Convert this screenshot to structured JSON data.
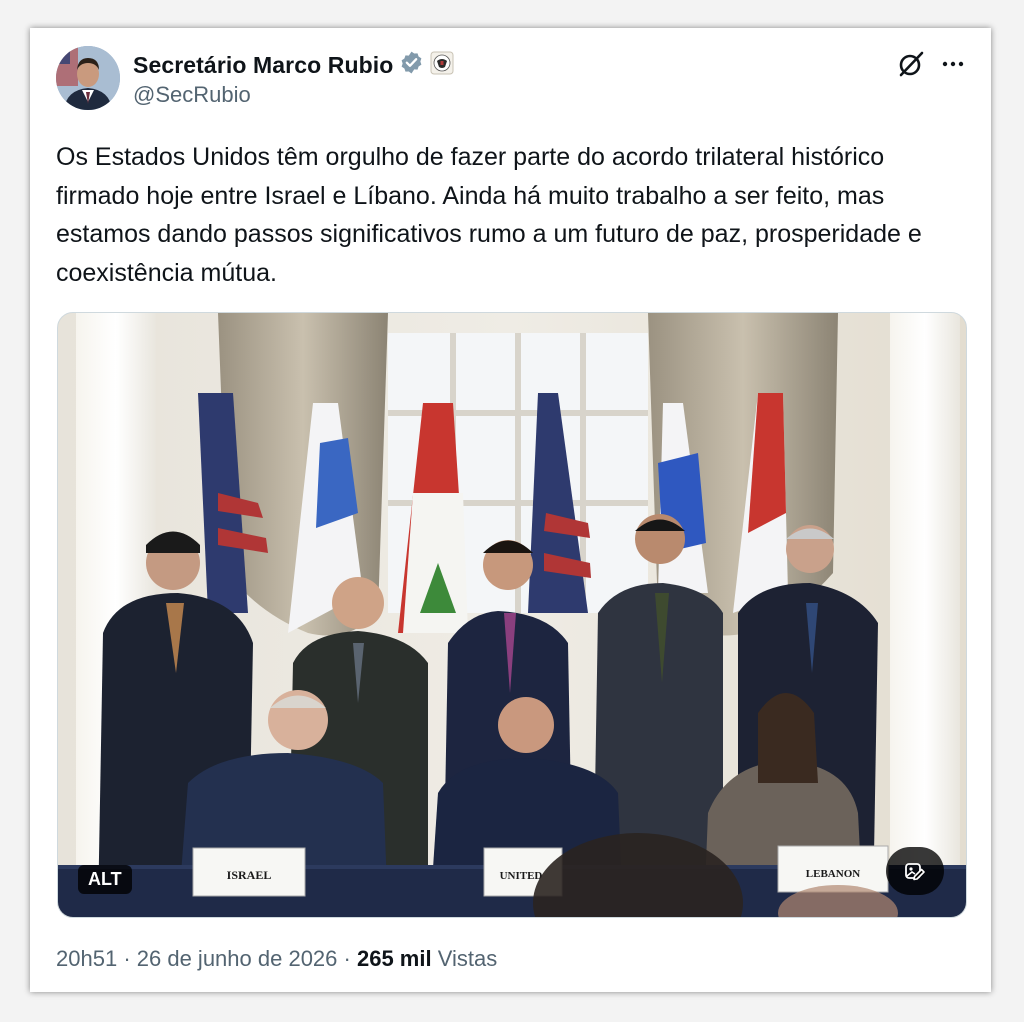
{
  "author": {
    "display_name": "Secretário Marco Rubio",
    "handle": "@SecRubio"
  },
  "icons": {
    "verified": "verified-badge-icon",
    "affiliation": "state-department-seal-icon",
    "grok": "grok-icon",
    "more": "more-options-icon",
    "media_edit": "image-edit-icon"
  },
  "colors": {
    "verified": "#829aab",
    "text": "#0f1419",
    "secondary": "#536471"
  },
  "tweet": {
    "text": "Os Estados Unidos têm orgulho de fazer parte do acordo trilateral histórico firmado hoje entre Israel e Líbano. Ainda há muito trabalho a ser feito, mas estamos dando passos significativos rumo a um futuro de paz, prosperidade e coexistência mútua."
  },
  "media": {
    "alt_badge": "ALT",
    "placards": [
      "ISRAEL",
      "UNITED",
      "LEBANON"
    ]
  },
  "meta": {
    "time": "20h51",
    "separator": "·",
    "date": "26 de junho de 2026",
    "views_count": "265 mil",
    "views_label": "Vistas"
  }
}
